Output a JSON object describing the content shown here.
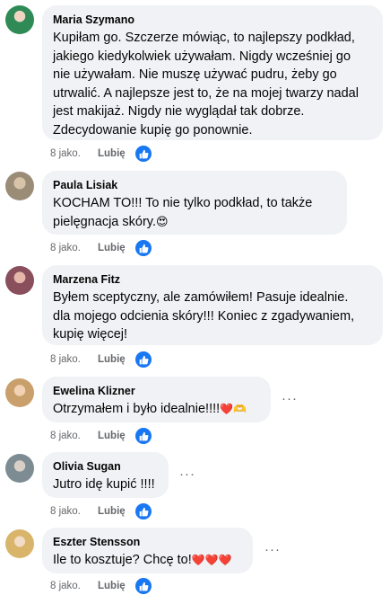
{
  "comments": [
    {
      "author": "Maria Szymano",
      "text": "Kupiłam go. Szczerze mówiąc, to najlepszy podkład,\njakiego kiedykolwiek używałam. Nigdy wcześniej go\nnie używałam. Nie muszę używać pudru, żeby go\nutrwalić. A najlepsze jest to, że na mojej twarzy nadal\njest makijaż. Nigdy nie wyglądał tak dobrze.\nZdecydowanie kupię go ponownie.",
      "time": "8 jako.",
      "like": "Lubię",
      "reaction_icon": "like-thumb-icon",
      "avatar_color": "#2f8a55"
    },
    {
      "author": "Paula Lisiak",
      "text": "KOCHAM TO!!! To nie tylko podkład, to także\npielęgnacja skóry.",
      "emoji": "😍",
      "time": "8 jako.",
      "like": "Lubię",
      "reaction_icon": "like-thumb-icon",
      "avatar_color": "#b7a88e"
    },
    {
      "author": "Marzena Fitz",
      "text": "Byłem sceptyczny, ale zamówiłem! Pasuje idealnie.\ndla mojego odcienia skóry!!! Koniec z zgadywaniem,\nkupię więcej!",
      "time": "8 jako.",
      "like": "Lubię",
      "reaction_icon": "like-thumb-icon",
      "avatar_color": "#8a4f5c"
    },
    {
      "author": "Ewelina Klizner",
      "text": "Otrzymałem i było idealnie!!!!",
      "emoji": "❤️🫶",
      "time": "8 jako.",
      "like": "Lubię",
      "reaction_icon": "like-thumb-icon",
      "avatar_color": "#c9a06b",
      "more": "···"
    },
    {
      "author": "Olivia Sugan",
      "text": "Jutro idę kupić !!!!",
      "time": "8 jako.",
      "like": "Lubię",
      "reaction_icon": "like-thumb-icon",
      "avatar_color": "#7d8b93",
      "more": "···"
    },
    {
      "author": "Eszter Stensson",
      "text": "Ile to kosztuje? Chcę to!",
      "emoji": "❤️❤️❤️",
      "time": "8 jako.",
      "like": "Lubię",
      "reaction_icon": "like-thumb-icon",
      "avatar_color": "#d9b56c",
      "more": "···"
    }
  ]
}
